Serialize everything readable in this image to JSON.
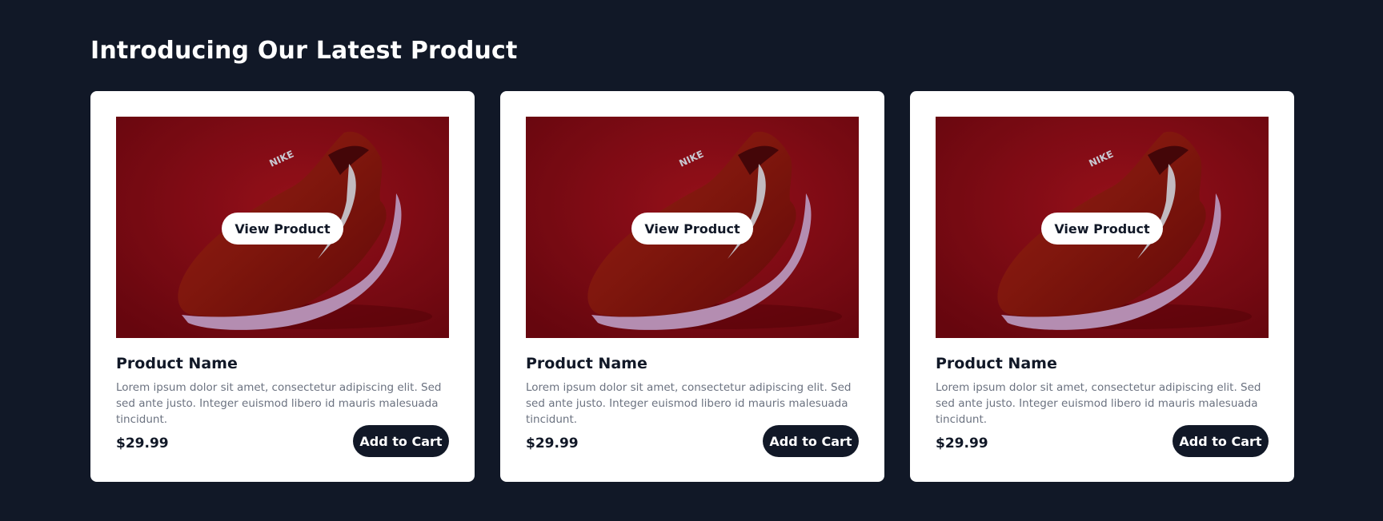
{
  "section": {
    "title": "Introducing Our Latest Product"
  },
  "colors": {
    "background": "#111827",
    "card": "#ffffff",
    "button_dark": "#111827",
    "image_red": "#8b0a14"
  },
  "products": [
    {
      "image_icon": "sneaker-image",
      "view_label": "View Product",
      "name": "Product Name",
      "description": "Lorem ipsum dolor sit amet, consectetur adipiscing elit. Sed sed ante justo. Integer euismod libero id mauris malesuada tincidunt.",
      "price": "$29.99",
      "add_label": "Add to Cart"
    },
    {
      "image_icon": "sneaker-image",
      "view_label": "View Product",
      "name": "Product Name",
      "description": "Lorem ipsum dolor sit amet, consectetur adipiscing elit. Sed sed ante justo. Integer euismod libero id mauris malesuada tincidunt.",
      "price": "$29.99",
      "add_label": "Add to Cart"
    },
    {
      "image_icon": "sneaker-image",
      "view_label": "View Product",
      "name": "Product Name",
      "description": "Lorem ipsum dolor sit amet, consectetur adipiscing elit. Sed sed ante justo. Integer euismod libero id mauris malesuada tincidunt.",
      "price": "$29.99",
      "add_label": "Add to Cart"
    }
  ]
}
